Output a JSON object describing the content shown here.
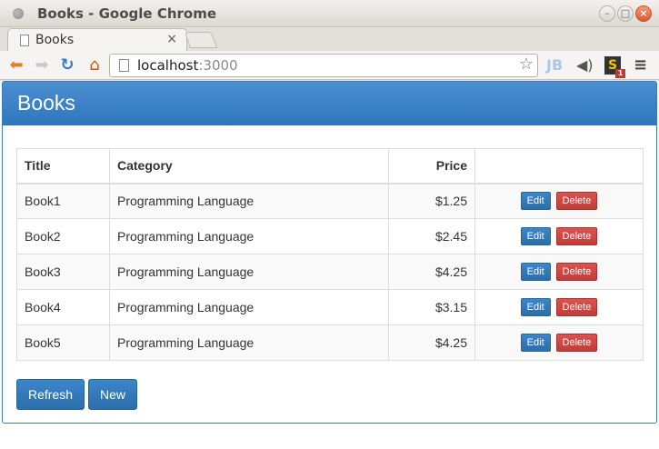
{
  "window": {
    "title": "Books - Google Chrome",
    "controls": {
      "minimize": "–",
      "maximize": "□",
      "close": "×"
    }
  },
  "tab": {
    "title": "Books",
    "close": "×"
  },
  "toolbar": {
    "url_host": "localhost",
    "url_port": ":3000",
    "ext_jb": "JB",
    "ext_s": "S",
    "ext_s_badge": "1"
  },
  "panel": {
    "title": "Books"
  },
  "table": {
    "headers": {
      "title": "Title",
      "category": "Category",
      "price": "Price"
    },
    "rows": [
      {
        "title": "Book1",
        "category": "Programming Language",
        "price": "$1.25"
      },
      {
        "title": "Book2",
        "category": "Programming Language",
        "price": "$2.45"
      },
      {
        "title": "Book3",
        "category": "Programming Language",
        "price": "$4.25"
      },
      {
        "title": "Book4",
        "category": "Programming Language",
        "price": "$3.15"
      },
      {
        "title": "Book5",
        "category": "Programming Language",
        "price": "$4.25"
      }
    ],
    "edit_label": "Edit",
    "delete_label": "Delete"
  },
  "buttons": {
    "refresh": "Refresh",
    "new": "New"
  },
  "colors": {
    "primary": "#337ab7",
    "danger": "#d9534f",
    "heading": "#3b82c4"
  }
}
